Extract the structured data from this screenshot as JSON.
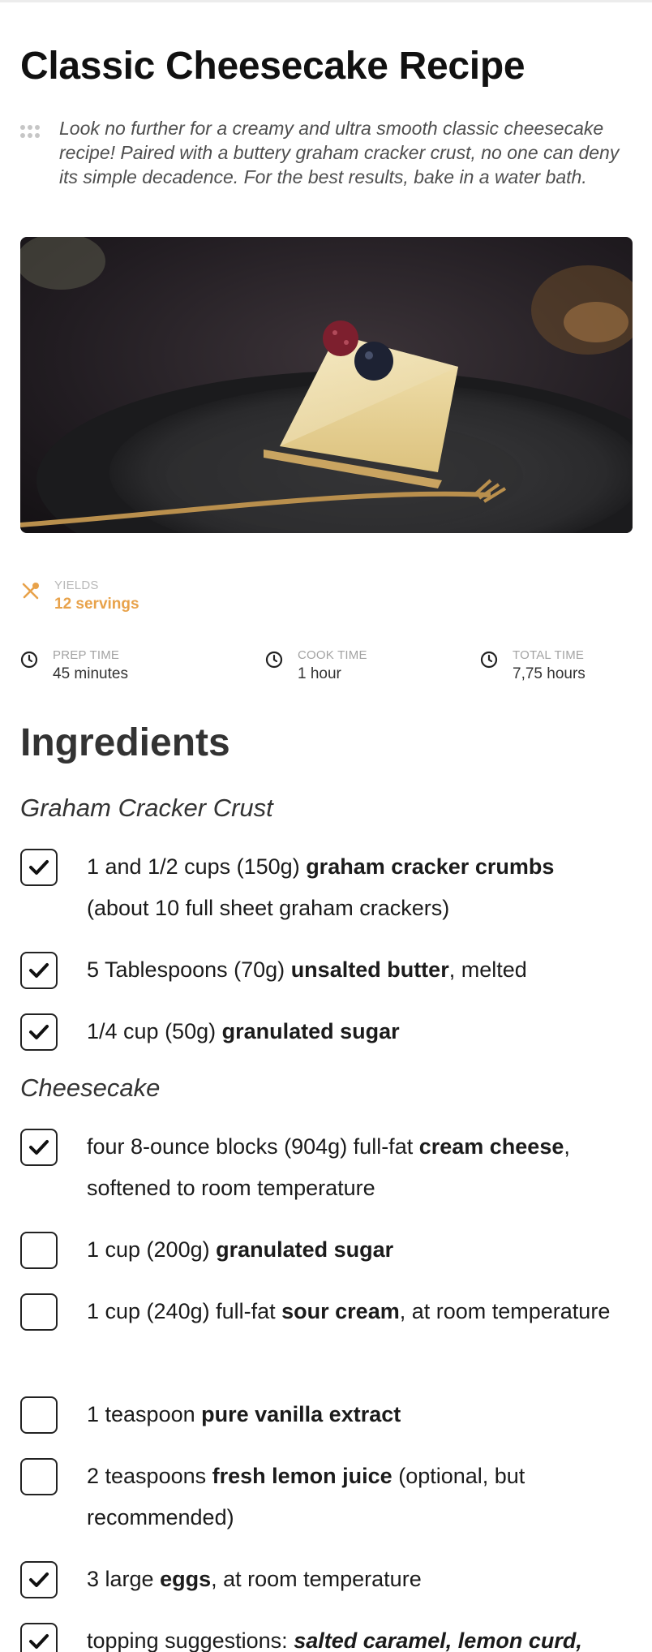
{
  "recipe": {
    "title": "Classic Cheesecake Recipe",
    "summary": "Look no further for a creamy and ultra smooth classic cheesecake recipe! Paired with a buttery graham cracker crust, no one can deny its simple decadence. For the best results, bake in a water bath."
  },
  "yields": {
    "label": "YIELDS",
    "value": "12 servings",
    "icon": "utensils-icon"
  },
  "times": {
    "prep": {
      "label": "PREP TIME",
      "value": "45 minutes"
    },
    "cook": {
      "label": "COOK TIME",
      "value": "1 hour"
    },
    "total": {
      "label": "TOTAL TIME",
      "value": "7,75 hours"
    }
  },
  "ingredients": {
    "heading": "Ingredients",
    "groups": [
      {
        "name": "Graham Cracker Crust",
        "items": [
          {
            "checked": true,
            "pre": "1 and 1/2 cups (150g) ",
            "bold": "graham cracker crumbs",
            "post": " (about 10 full sheet graham crackers)"
          },
          {
            "checked": true,
            "pre": "5 Tablespoons (70g) ",
            "bold": "unsalted butter",
            "post": ", melted"
          },
          {
            "checked": true,
            "pre": "1/4 cup (50g) ",
            "bold": "granulated sugar",
            "post": ""
          }
        ]
      },
      {
        "name": "Cheesecake",
        "items": [
          {
            "checked": true,
            "pre": "four 8-ounce blocks (904g) full-fat ",
            "bold": "cream cheese",
            "post": ", softened to room temperature"
          },
          {
            "checked": false,
            "pre": "1 cup (200g) ",
            "bold": "granulated sugar",
            "post": ""
          },
          {
            "checked": false,
            "pre": "1 cup (240g) full-fat ",
            "bold": "sour cream",
            "post": ", at room temperature"
          },
          {
            "checked": false,
            "pre": "1 teaspoon ",
            "bold": "pure vanilla extract",
            "post": ""
          },
          {
            "checked": false,
            "pre": "2 teaspoons ",
            "bold": "fresh lemon juice",
            "post": " (optional, but recommended)"
          },
          {
            "checked": true,
            "pre": "3 large ",
            "bold": "eggs",
            "post": ", at room temperature"
          },
          {
            "checked": true,
            "pre": "topping suggestions: ",
            "bold": "salted caramel, lemon curd,",
            "post": ""
          }
        ]
      }
    ]
  },
  "colors": {
    "accent": "#e8a24a",
    "text": "#1b1b1b",
    "muted": "#a3a3a3"
  }
}
